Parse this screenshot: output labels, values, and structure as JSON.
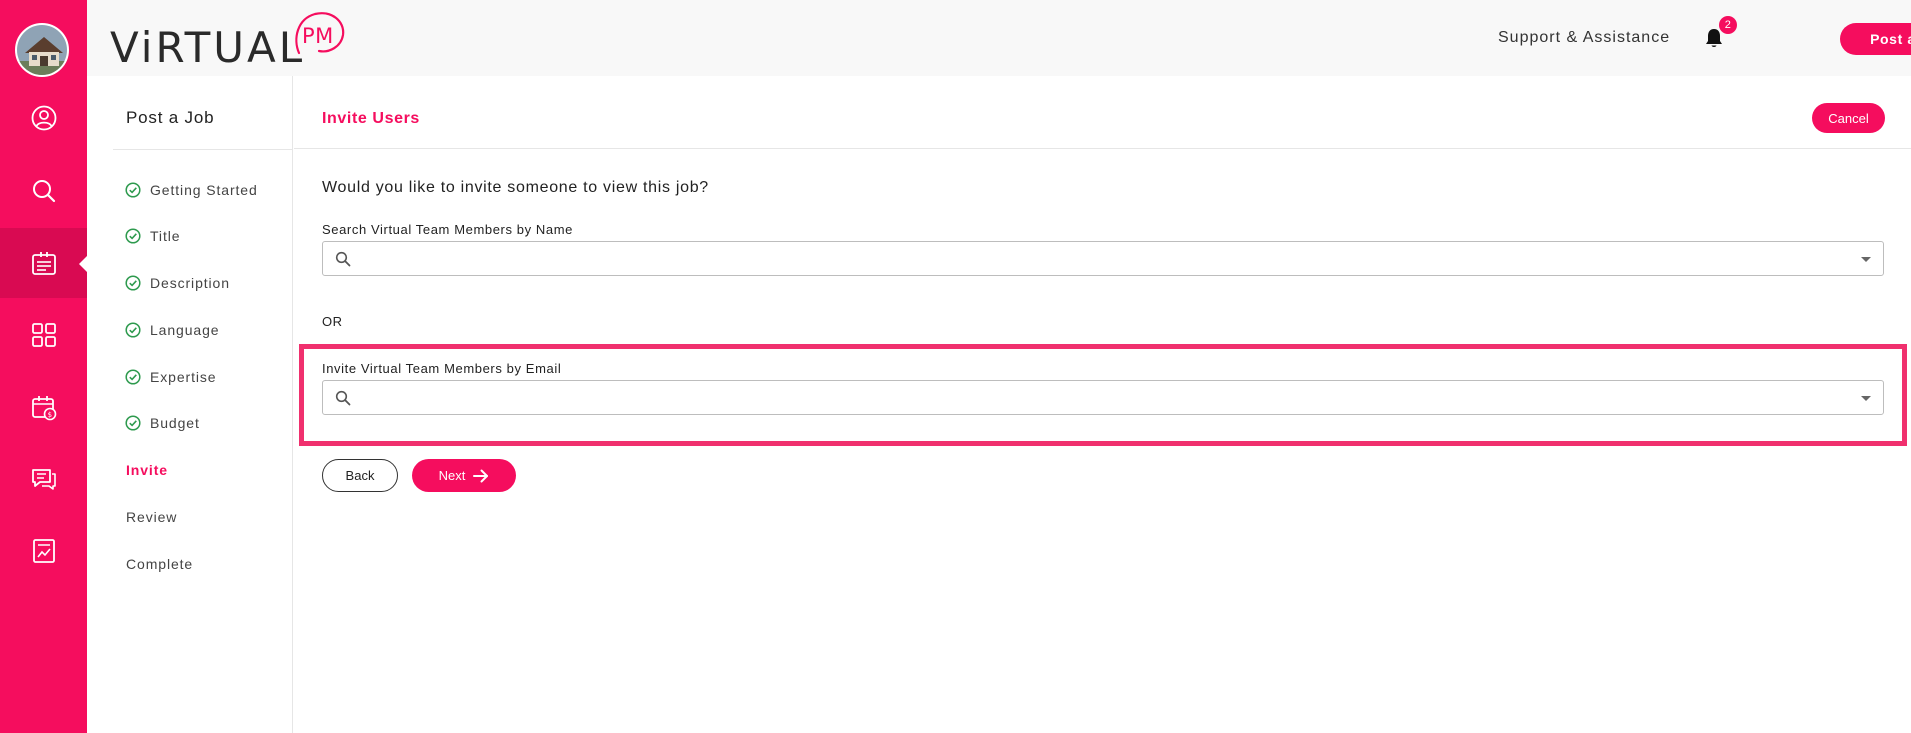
{
  "brand": {
    "logo_main": "ViRTUAL",
    "logo_accent": "PM",
    "accent_color": "#f50d5e"
  },
  "header": {
    "support_label": "Support & Assistance",
    "notification_count": "2",
    "post_job_label": "Post a Job"
  },
  "rail": {
    "icons": [
      "avatar",
      "user-icon",
      "search-icon",
      "job-posting-icon",
      "grid-icon",
      "calendar-money-icon",
      "chat-icon",
      "report-icon"
    ],
    "active_item": "job-posting-icon"
  },
  "steps": {
    "title": "Post a Job",
    "items": [
      {
        "label": "Getting Started",
        "state": "done"
      },
      {
        "label": "Title",
        "state": "done"
      },
      {
        "label": "Description",
        "state": "done"
      },
      {
        "label": "Language",
        "state": "done"
      },
      {
        "label": "Expertise",
        "state": "done"
      },
      {
        "label": "Budget",
        "state": "done"
      },
      {
        "label": "Invite",
        "state": "current"
      },
      {
        "label": "Review",
        "state": "pending"
      },
      {
        "label": "Complete",
        "state": "pending"
      }
    ]
  },
  "main": {
    "title": "Invite Users",
    "cancel_label": "Cancel",
    "question": "Would you like to invite someone to view this job?",
    "search_by_name_label": "Search Virtual Team Members by Name",
    "search_by_name_value": "",
    "or_label": "OR",
    "invite_by_email_label": "Invite Virtual Team Members by Email",
    "invite_by_email_value": "",
    "back_label": "Back",
    "next_label": "Next"
  }
}
